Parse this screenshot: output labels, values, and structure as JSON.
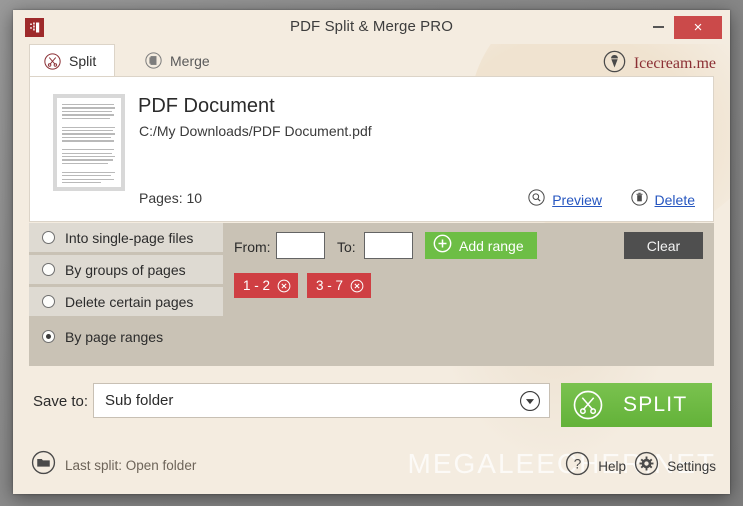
{
  "window": {
    "title": "PDF Split & Merge PRO",
    "app_icon": "pdf-split-merge-app-icon",
    "minimize_label": "–",
    "close_label": "×",
    "close_color": "#cb4a4a",
    "background_color": "#f4ece0"
  },
  "tabs": [
    {
      "id": "split",
      "label": "Split",
      "icon": "scissors-icon",
      "active": true
    },
    {
      "id": "merge",
      "label": "Merge",
      "icon": "merge-pages-icon",
      "active": false
    }
  ],
  "brand": {
    "label": "Icecream.me",
    "icon": "ice-cream-cone-icon",
    "color": "#8b2f34"
  },
  "file": {
    "thumbnail_icon": "pdf-page-thumbnail",
    "name": "PDF Document",
    "path": "C:/My Downloads/PDF Document.pdf",
    "pages_label": "Pages: 10",
    "actions": [
      {
        "id": "preview",
        "label": "Preview",
        "icon": "magnifier-icon"
      },
      {
        "id": "delete",
        "label": "Delete",
        "icon": "trash-icon"
      }
    ],
    "link_color": "#2656c0"
  },
  "split_options": {
    "items": [
      {
        "id": "single-page-files",
        "label": "Into single-page files",
        "selected": false
      },
      {
        "id": "groups-of-pages",
        "label": "By groups of pages",
        "selected": false
      },
      {
        "id": "delete-certain-pages",
        "label": "Delete certain pages",
        "selected": false
      },
      {
        "id": "page-ranges",
        "label": "By page ranges",
        "selected": true
      }
    ]
  },
  "range_controls": {
    "from_label": "From:",
    "from_value": "",
    "from_placeholder": "",
    "to_label": "To:",
    "to_value": "",
    "to_placeholder": "",
    "add_range_label": "Add range",
    "add_range_icon": "plus-circle-icon",
    "add_range_color": "#6dbe45",
    "clear_label": "Clear",
    "clear_color": "#4f4f4f",
    "chips": [
      {
        "label": "1 - 2",
        "remove_icon": "close-circle-icon"
      },
      {
        "label": "3 - 7",
        "remove_icon": "close-circle-icon"
      }
    ],
    "chip_color": "#cf3f43"
  },
  "save_row": {
    "label": "Save to:",
    "value": "Sub folder",
    "placeholder": "Sub folder",
    "dropdown_icon": "chevron-down-circle-icon",
    "split_button_label": "SPLIT",
    "split_button_icon": "scissors-icon",
    "split_button_color": "#6dbe45"
  },
  "status_bar": {
    "last_split_label": "Last split: Open folder",
    "last_split_icon": "folder-icon",
    "help_label": "Help",
    "help_icon": "question-circle-icon",
    "settings_label": "Settings",
    "settings_icon": "gear-icon",
    "watermark": "MEGALEECHER.NET"
  }
}
